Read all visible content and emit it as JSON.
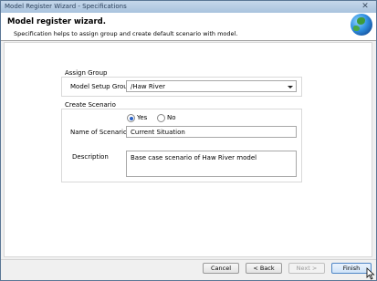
{
  "window": {
    "title": "Model Register Wizard - Specifications",
    "close_glyph": "✕"
  },
  "header": {
    "title": "Model register wizard.",
    "subtitle": "Specification helps to assign group and create default scenario with model.",
    "icon": "globe-icon"
  },
  "assign_group": {
    "group_title": "Assign Group",
    "setup_label": "Model Setup Group",
    "setup_value": "/Haw River"
  },
  "create_scenario": {
    "group_title": "Create Scenario",
    "yes_label": "Yes",
    "no_label": "No",
    "selected": "Yes",
    "name_label": "Name of Scenario",
    "name_value": "Current Situation",
    "description_label": "Description",
    "description_value": "Base case scenario of Haw River  model"
  },
  "footer": {
    "cancel_label": "Cancel",
    "back_label": "< Back",
    "next_label": "Next >",
    "finish_label": "Finish"
  },
  "colors": {
    "accent": "#2a62c7",
    "titlebar": "#a9c3de"
  }
}
